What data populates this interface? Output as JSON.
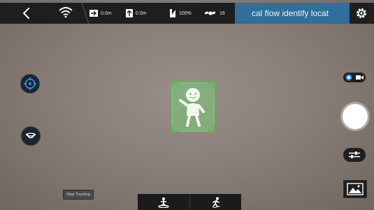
{
  "topbar": {
    "distance_value": "0.0m",
    "altitude_value": "0.0m",
    "battery_value": "100%",
    "satellites_value": "16",
    "mode_title": "cal flow identify locat"
  },
  "controls": {
    "stop_tracking_label": "Stop Tracking"
  },
  "colors": {
    "topbar_bg": "#1e1e1e",
    "title_bg": "#2f6f99",
    "tracking_box": "#5ed15e",
    "accent_blue": "#2f8fe0"
  },
  "icons": {
    "back": "chevron-left-icon",
    "wifi": "wifi-icon",
    "distance": "distance-arrow-icon",
    "altitude": "altitude-arrow-icon",
    "battery": "battery-icon",
    "satellite": "satellite-icon",
    "settings": "gear-icon",
    "target": "crosshair-target-icon",
    "drone": "drone-icon",
    "camera": "camera-icon",
    "video": "video-icon",
    "sliders": "sliders-icon",
    "gallery": "image-gallery-icon",
    "follow_mode": "person-on-platform-icon",
    "walk_mode": "walking-person-icon"
  }
}
